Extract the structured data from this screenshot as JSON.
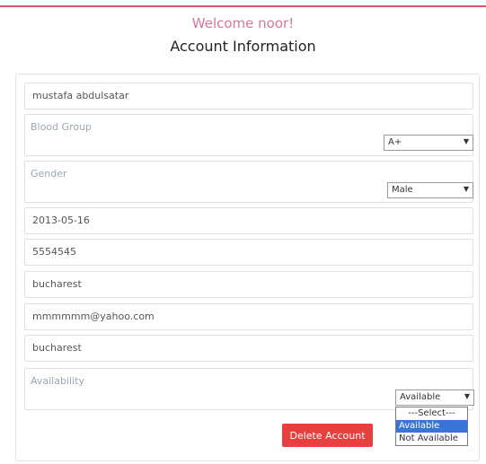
{
  "header": {
    "welcome": "Welcome noor!",
    "title": "Account Information"
  },
  "form": {
    "name": "mustafa abdulsatar",
    "blood_group_label": "Blood Group",
    "blood_group_value": "A+",
    "gender_label": "Gender",
    "gender_value": "Male",
    "date": "2013-05-16",
    "phone": "5554545",
    "city": "bucharest",
    "email": "mmmmmm@yahoo.com",
    "address": "bucharest",
    "availability_label": "Availability",
    "availability_value": "Available",
    "availability_options": [
      "---Select---",
      "Available",
      "Not Available"
    ],
    "availability_highlighted": "Available",
    "delete_label": "Delete Account"
  },
  "colors": {
    "accent_line": "#d9536f",
    "welcome_text": "#d9779a",
    "delete_button": "#e8403f",
    "option_highlight": "#3875d7"
  }
}
